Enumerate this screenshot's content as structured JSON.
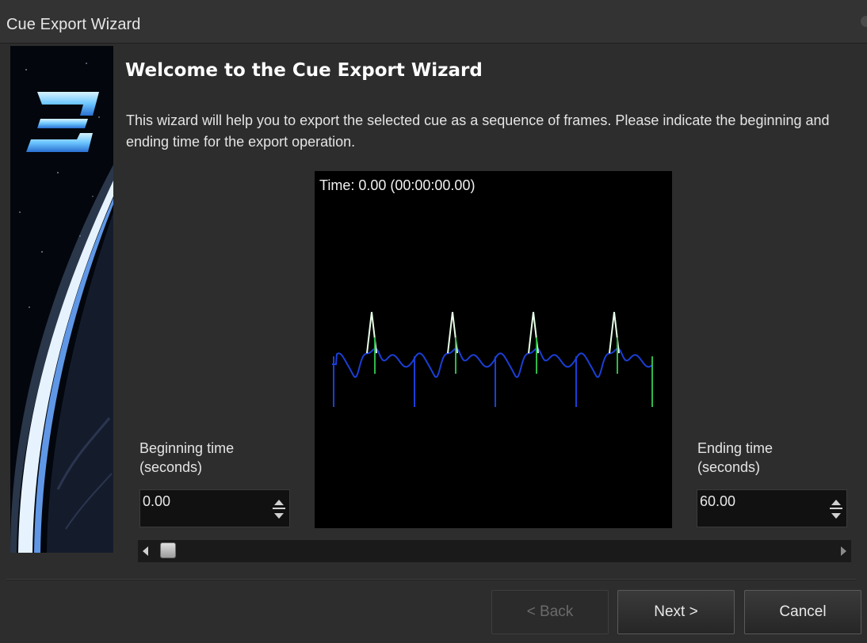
{
  "window": {
    "title": "Cue Export Wizard"
  },
  "banner": {
    "logo_text": "3"
  },
  "content": {
    "heading": "Welcome to the Cue Export Wizard",
    "description": "This wizard will help you to export the selected cue as a sequence of frames. Please indicate the beginning and ending time for the export operation."
  },
  "preview": {
    "time_label": "Time: 0.00 (00:00:00.00)"
  },
  "beginning": {
    "label_line1": "Beginning time",
    "label_line2": "(seconds)",
    "value": "0.00"
  },
  "ending": {
    "label_line1": "Ending time",
    "label_line2": "(seconds)",
    "value": "60.00"
  },
  "timeline": {
    "position_fraction": 0.0
  },
  "buttons": {
    "back": "< Back",
    "next": "Next >",
    "cancel": "Cancel"
  },
  "colors": {
    "waveform_primary": "#1a3fd6",
    "waveform_secondary": "#2fb84a",
    "waveform_highlight": "#e8ffe8",
    "logo": "#7fd0ff"
  }
}
